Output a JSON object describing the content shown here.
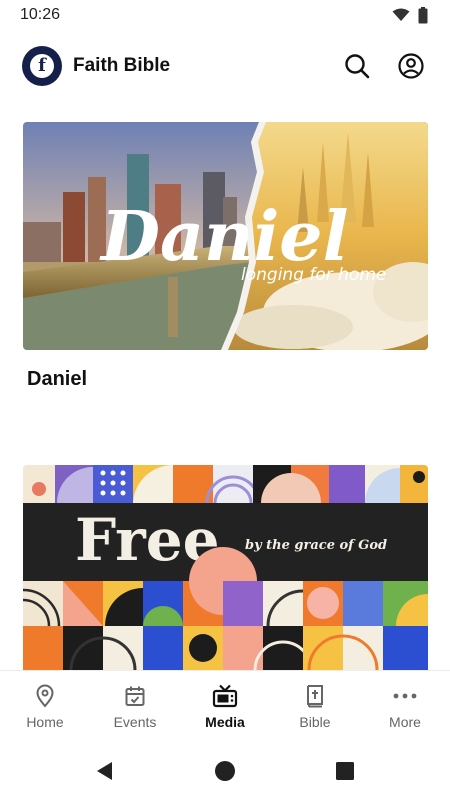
{
  "status_bar": {
    "time": "10:26"
  },
  "header": {
    "title": "Faith Bible",
    "logo_letter": "f"
  },
  "feed": {
    "items": [
      {
        "title": "Daniel",
        "banner_title": "Daniel",
        "banner_subtitle": "longing for home"
      },
      {
        "title": "",
        "banner_title": "Free",
        "banner_subtitle": "by the grace of God"
      }
    ]
  },
  "bottom_nav": {
    "items": [
      {
        "label": "Home",
        "icon": "location-pin-icon"
      },
      {
        "label": "Events",
        "icon": "calendar-icon"
      },
      {
        "label": "Media",
        "icon": "tv-icon",
        "active": true
      },
      {
        "label": "Bible",
        "icon": "bible-icon"
      },
      {
        "label": "More",
        "icon": "more-dots-icon"
      }
    ]
  },
  "colors": {
    "logo_bg": "#14204a",
    "active_nav": "#111111",
    "inactive_nav": "#666666"
  }
}
